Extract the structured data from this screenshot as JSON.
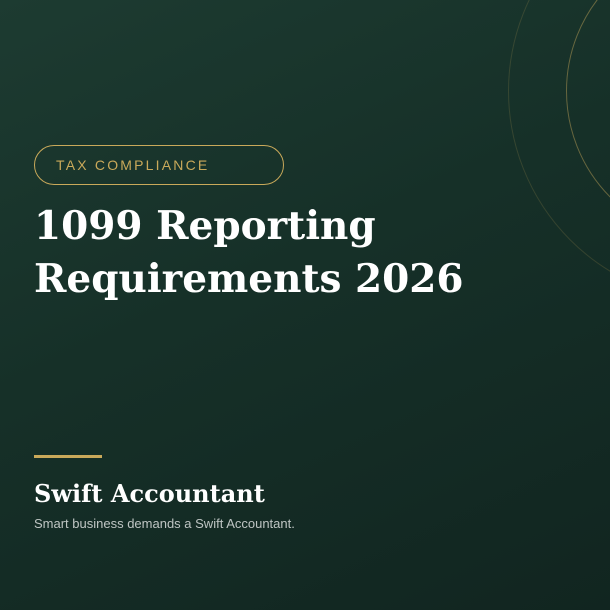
{
  "tag": {
    "label": "TAX COMPLIANCE"
  },
  "title": {
    "lines": [
      "1099 Reporting",
      "Requirements 2026"
    ]
  },
  "brand": {
    "name": "Swift Accountant",
    "tagline": "Smart business demands a Swift Accountant."
  },
  "colors": {
    "background": "#163028",
    "accent_gold": "#c9a95a",
    "text_primary": "#ffffff",
    "text_secondary": "#b9c2bd"
  }
}
